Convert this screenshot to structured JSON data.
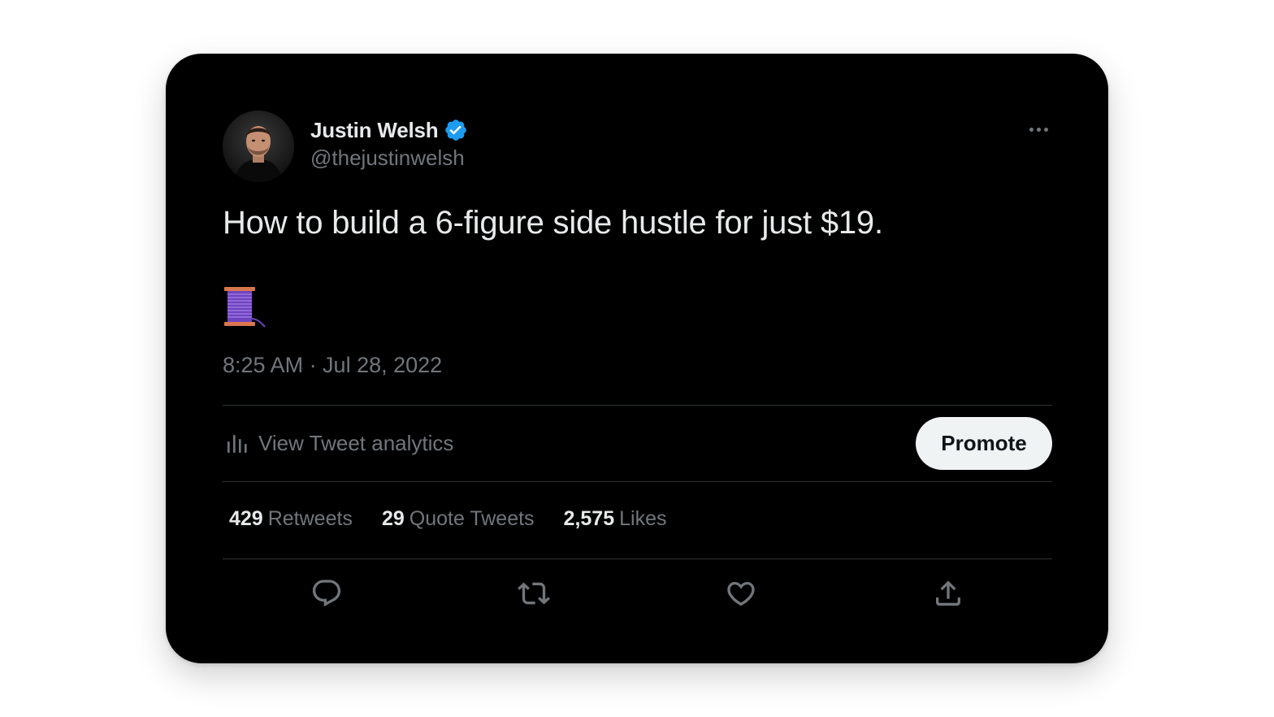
{
  "tweet": {
    "author_name": "Justin Welsh",
    "author_handle": "@thejustinwelsh",
    "text": "How to build a 6-figure side hustle for just $19.",
    "emoji": "🧵",
    "timestamp": "8:25 AM · Jul 28, 2022"
  },
  "analytics": {
    "label": "View Tweet analytics"
  },
  "promote_label": "Promote",
  "stats": [
    {
      "count": "429",
      "label": "Retweets"
    },
    {
      "count": "29",
      "label": "Quote Tweets"
    },
    {
      "count": "2,575",
      "label": "Likes"
    }
  ],
  "actions": [
    "reply-icon",
    "retweet-icon",
    "like-icon",
    "share-icon"
  ],
  "colors": {
    "background": "#000000",
    "primary_text": "#e7e9ea",
    "secondary_text": "#71767b",
    "divider": "#2f3336",
    "verified": "#1d9bf0",
    "promote_bg": "#eff3f4"
  }
}
